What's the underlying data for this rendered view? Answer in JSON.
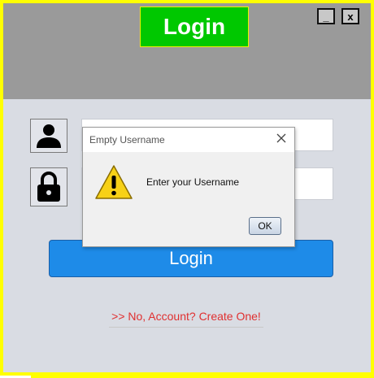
{
  "window": {
    "title": "Login",
    "minimize_label": "_",
    "close_label": "x"
  },
  "form": {
    "username_value": "",
    "password_value": "",
    "login_button": "Login",
    "create_account_link": ">> No, Account? Create One!"
  },
  "dialog": {
    "title": "Empty Username",
    "message": "Enter your Username",
    "ok_button": "OK",
    "icon": "warning-icon"
  },
  "icons": {
    "username": "user-icon",
    "password": "lock-icon"
  },
  "colors": {
    "frame_border": "#ffff00",
    "header_bg": "#9a9a9a",
    "title_bg": "#00c800",
    "login_button_bg": "#1e8be8",
    "link_color": "#e03030",
    "body_bg": "#d9dce3"
  }
}
